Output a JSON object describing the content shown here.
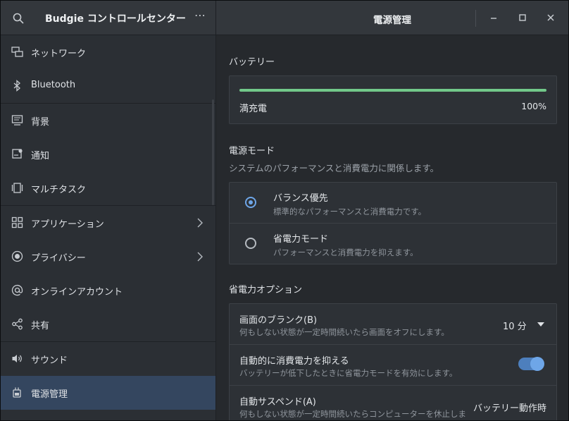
{
  "app": {
    "sidebar_title": "Budgie コントロールセンター",
    "more_label": "⋯",
    "page_title": "電源管理"
  },
  "sidebar": {
    "items": [
      {
        "label": "ネットワーク",
        "icon": "network-icon"
      },
      {
        "label": "Bluetooth",
        "icon": "bluetooth-icon"
      },
      {
        "label": "背景",
        "icon": "background-icon"
      },
      {
        "label": "通知",
        "icon": "notifications-icon"
      },
      {
        "label": "マルチタスク",
        "icon": "multitasking-icon"
      },
      {
        "label": "アプリケーション",
        "icon": "applications-icon"
      },
      {
        "label": "プライバシー",
        "icon": "privacy-icon"
      },
      {
        "label": "オンラインアカウント",
        "icon": "online-accounts-icon"
      },
      {
        "label": "共有",
        "icon": "sharing-icon"
      },
      {
        "label": "サウンド",
        "icon": "sound-icon"
      },
      {
        "label": "電源管理",
        "icon": "power-icon"
      }
    ],
    "active_item": "電源管理"
  },
  "battery": {
    "section_title": "バッテリー",
    "status": "満充電",
    "percent_text": "100%",
    "level": 1.0,
    "bar_color": "#72c98a"
  },
  "power_mode": {
    "section_title": "電源モード",
    "section_subtitle": "システムのパフォーマンスと消費電力に関係します。",
    "options": [
      {
        "title": "バランス優先",
        "subtitle": "標準的なパフォーマンスと消費電力です。",
        "selected": true
      },
      {
        "title": "省電力モード",
        "subtitle": "パフォーマンスと消費電力を抑えます。",
        "selected": false
      }
    ]
  },
  "power_saving": {
    "section_title": "省電力オプション",
    "blank_screen": {
      "title": "画面のブランク(B)",
      "subtitle": "何もしない状態が一定時間続いたら画面をオフにします。",
      "value": "10 分"
    },
    "auto_power_saver": {
      "title": "自動的に消費電力を抑える",
      "subtitle": "バッテリーが低下したときに省電力モードを有効にします。",
      "enabled": true
    },
    "auto_suspend": {
      "title": "自動サスペンド(A)",
      "subtitle": "何もしない状態が一定時間続いたらコンピューターを休止しま…",
      "value": "バッテリー動作時"
    }
  },
  "colors": {
    "accent": "#6ea6e8",
    "selected_row": "#34465f"
  }
}
